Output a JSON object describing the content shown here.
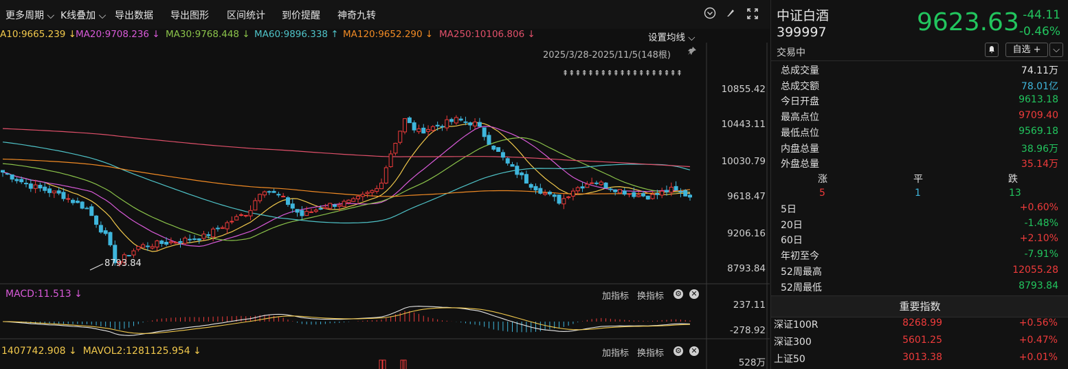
{
  "toolbar": {
    "items": [
      "更多周期",
      "K线叠加",
      "导出数据",
      "导出图形",
      "区间统计",
      "到价提醒",
      "神奇九转"
    ],
    "icons": [
      "collapse-circle-icon",
      "brush-icon",
      "fullscreen-icon"
    ]
  },
  "ma_lines": [
    {
      "text": "A10:9665.239 ↓",
      "color": "#f2c94c"
    },
    {
      "text": "MA20:9708.236 ↓",
      "color": "#d85ad8"
    },
    {
      "text": "MA30:9768.448 ↓",
      "color": "#8bc34a"
    },
    {
      "text": "MA60:9896.338 ↑",
      "color": "#4fc3c8"
    },
    {
      "text": "MA120:9652.290 ↓",
      "color": "#f08a24"
    },
    {
      "text": "MA250:10106.806 ↓",
      "color": "#e0506a"
    }
  ],
  "set_ma_label": "设置均线",
  "range_label": "2025/3/28-2025/11/5(148根)",
  "signal_arrows": "⇞⇞⇞⇞⇞⇞⇞⇞⇞⇞⇞⇞⇞⇞⇞⇞⇞⇞⇞",
  "price_axis": [
    "10855.42",
    "10443.11",
    "10030.79",
    "9618.47",
    "9206.16",
    "8793.84"
  ],
  "low_marker": "8793.84",
  "macd": {
    "label": "MACD:11.513 ↓",
    "axis_top": "237.11",
    "axis_bottom": "-278.92"
  },
  "indicator_buttons": {
    "add": "加指标",
    "switch": "换指标"
  },
  "vol": {
    "label": "1407742.908 ↓  MAVOL2:1281125.954 ↓",
    "axis_top": "528万"
  },
  "quote": {
    "name": "中证白酒",
    "code": "399997",
    "price": "9623.63",
    "change": "-44.11",
    "change_pct": "-0.46%",
    "status": "交易中",
    "watch_button": "自选 +"
  },
  "stats": [
    {
      "k": "总成交量",
      "v": "74.11万",
      "c": "white"
    },
    {
      "k": "总成交额",
      "v": "78.01亿",
      "c": "cyan"
    },
    {
      "k": "今日开盘",
      "v": "9613.18",
      "c": "green"
    },
    {
      "k": "最高点位",
      "v": "9709.40",
      "c": "red"
    },
    {
      "k": "最低点位",
      "v": "9569.18",
      "c": "green"
    },
    {
      "k": "内盘总量",
      "v": "38.96万",
      "c": "green"
    },
    {
      "k": "外盘总量",
      "v": "35.14万",
      "c": "red"
    }
  ],
  "breadth": {
    "up_label": "涨",
    "flat_label": "平",
    "down_label": "跌",
    "up": "5",
    "flat": "1",
    "down": "13"
  },
  "periods": [
    {
      "k": "5日",
      "v": "+0.60%",
      "c": "red"
    },
    {
      "k": "20日",
      "v": "-1.48%",
      "c": "green"
    },
    {
      "k": "60日",
      "v": "+2.10%",
      "c": "red"
    },
    {
      "k": "年初至今",
      "v": "-7.91%",
      "c": "green"
    },
    {
      "k": "52周最高",
      "v": "12055.28",
      "c": "red"
    },
    {
      "k": "52周最低",
      "v": "8793.84",
      "c": "green"
    }
  ],
  "important_title": "重要指数",
  "indices": [
    {
      "name": "深证100R",
      "value": "8268.99",
      "pct": "+0.56%"
    },
    {
      "name": "深证300",
      "value": "5601.25",
      "pct": "+0.47%"
    },
    {
      "name": "上证50",
      "value": "3013.38",
      "pct": "+0.01%"
    }
  ],
  "chart_data": {
    "type": "candlestick",
    "ylim": [
      8793.84,
      10855.42
    ],
    "period": "2025/3/28-2025/11/5",
    "bars": 148
  }
}
